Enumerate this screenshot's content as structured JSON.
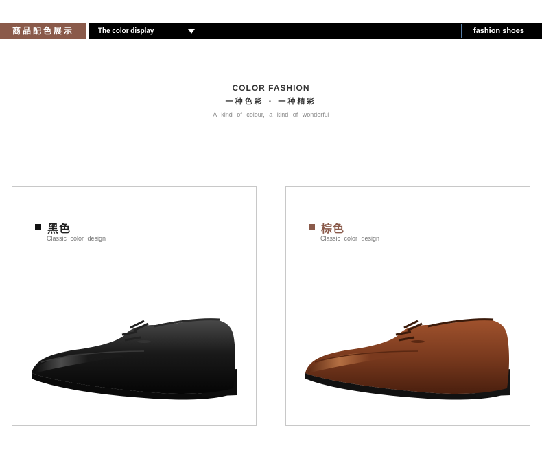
{
  "banner": {
    "left_label": "商品配色展示",
    "title": "The color display",
    "right_label": "fashion shoes",
    "left_bg": "#8a5a4a",
    "right_bg": "#000000",
    "caret_icon": "caret-down-icon"
  },
  "heading": {
    "en": "COLOR FASHION",
    "cn": "一种色彩 · 一种精彩",
    "sub": "A kind of colour, a kind of wonderful"
  },
  "cards": [
    {
      "name": "黑色",
      "desc": "Classic color design",
      "swatch_color": "#111111",
      "shoe_color": "#151515"
    },
    {
      "name": "棕色",
      "desc": "Classic color design",
      "swatch_color": "#8a5a4a",
      "shoe_color": "#7a3a1e"
    }
  ]
}
